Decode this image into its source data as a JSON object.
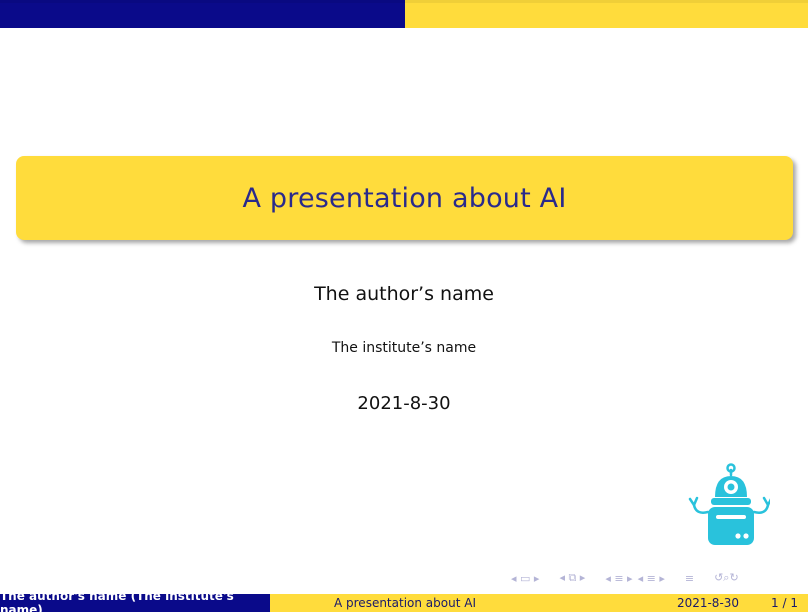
{
  "slide": {
    "title": "A presentation about AI",
    "author": "The author’s name",
    "institute": "The institute’s name",
    "date": "2021-8-30"
  },
  "footer": {
    "author_institute": "The author's name  (The institute's name)",
    "title": "A presentation about AI",
    "date": "2021-8-30",
    "page": "1 / 1"
  },
  "logo": {
    "icon": "robot-icon"
  },
  "navigation": {
    "icons": [
      "nav-frame-icon",
      "nav-subsection-icon",
      "nav-section-icon",
      "nav-section-icon",
      "nav-align-icon",
      "nav-search-icon"
    ]
  },
  "colors": {
    "navy": "#0a0a8a",
    "yellow": "#ffdc3c",
    "title_text": "#2a2a8c",
    "robot": "#29c2dc"
  }
}
